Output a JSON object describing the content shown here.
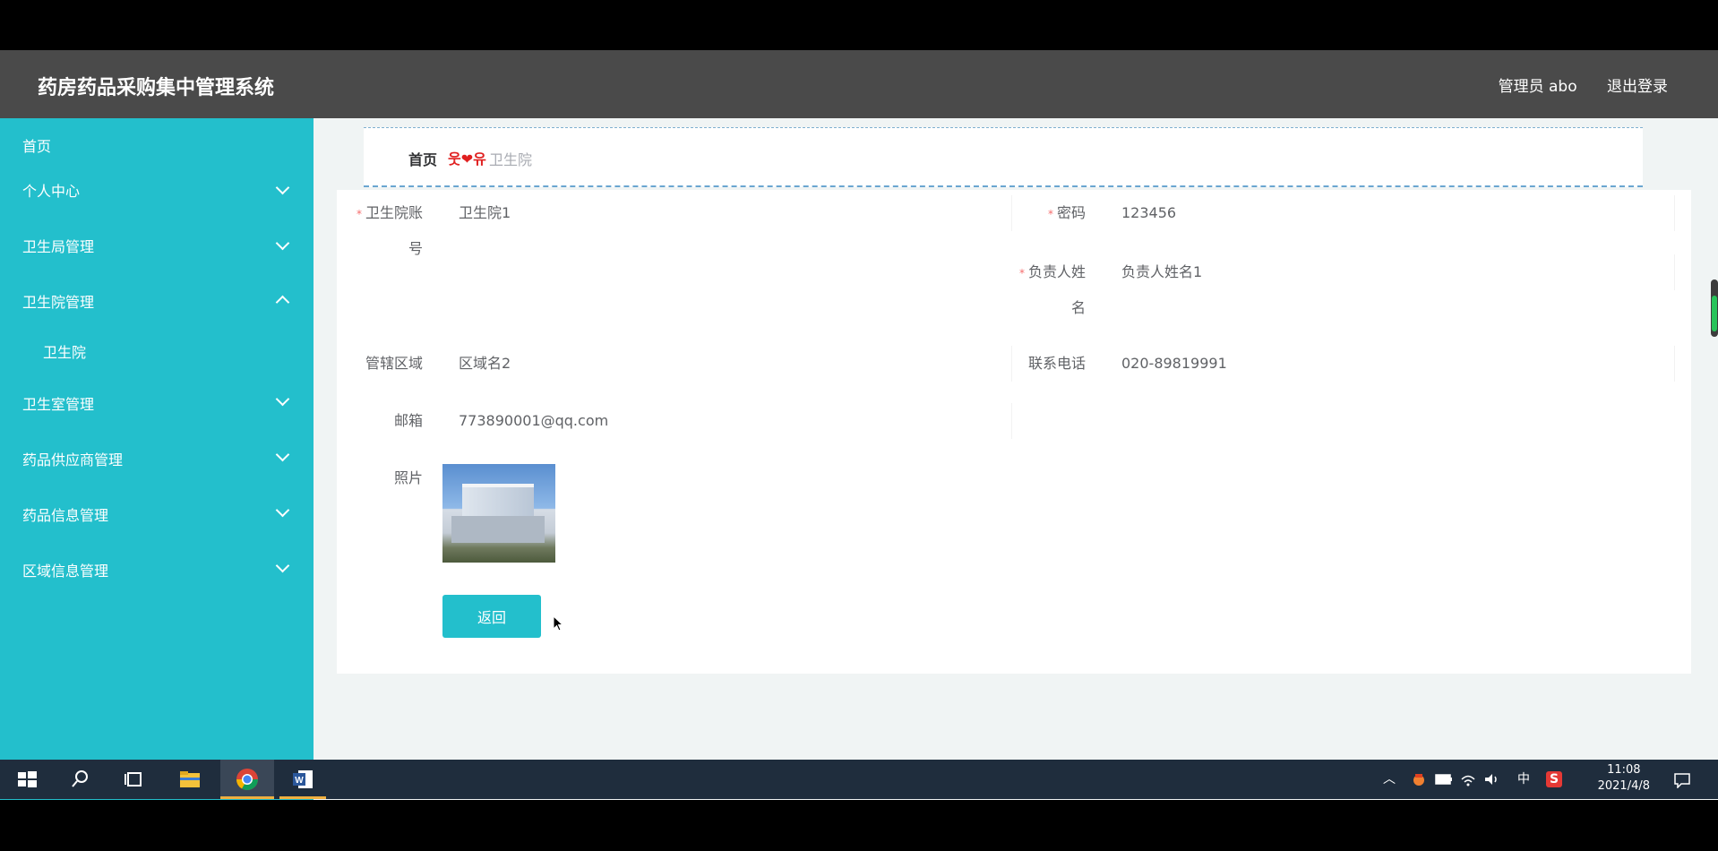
{
  "header": {
    "title": "药房药品采购集中管理系统",
    "user_label": "管理员 abo",
    "logout_label": "退出登录"
  },
  "sidebar": {
    "items": [
      {
        "label": "首页"
      },
      {
        "label": "个人中心"
      },
      {
        "label": "卫生局管理"
      },
      {
        "label": "卫生院管理"
      },
      {
        "label": "卫生院"
      },
      {
        "label": "卫生室管理"
      },
      {
        "label": "药品供应商管理"
      },
      {
        "label": "药品信息管理"
      },
      {
        "label": "区域信息管理"
      }
    ]
  },
  "breadcrumb": {
    "home": "首页",
    "separator": "웃❤유",
    "current": "卫生院"
  },
  "form": {
    "account_label_1": "卫生院账",
    "account_label_2": "号",
    "account_value": "卫生院1",
    "password_label": "密码",
    "password_value": "123456",
    "manager_label_1": "负责人姓",
    "manager_label_2": "名",
    "manager_value": "负责人姓名1",
    "region_label": "管辖区域",
    "region_value": "区域名2",
    "phone_label": "联系电话",
    "phone_value": "020-89819991",
    "email_label": "邮箱",
    "email_value": "773890001@qq.com",
    "photo_label": "照片",
    "back_label": "返回"
  },
  "taskbar": {
    "ime": "中",
    "time": "11:08",
    "date": "2021/4/8"
  },
  "colors": {
    "accent": "#23bfcc",
    "header": "#4a4a4a",
    "taskbar": "#1f2d3d"
  }
}
